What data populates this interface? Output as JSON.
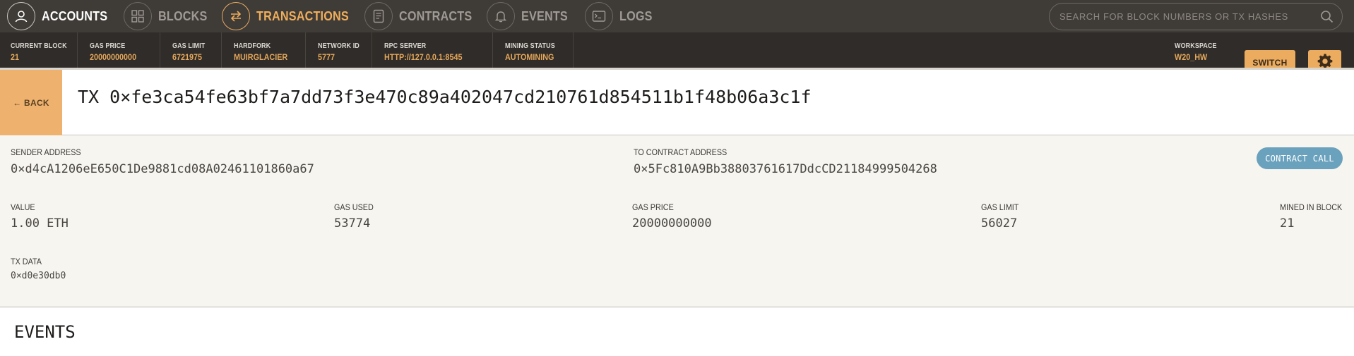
{
  "nav": {
    "items": [
      {
        "label": "ACCOUNTS",
        "icon": "account-icon",
        "state": "active"
      },
      {
        "label": "BLOCKS",
        "icon": "blocks-icon",
        "state": "inactive"
      },
      {
        "label": "TRANSACTIONS",
        "icon": "transactions-icon",
        "state": "selected"
      },
      {
        "label": "CONTRACTS",
        "icon": "contracts-icon",
        "state": "inactive"
      },
      {
        "label": "EVENTS",
        "icon": "bell-icon",
        "state": "inactive"
      },
      {
        "label": "LOGS",
        "icon": "logs-icon",
        "state": "inactive"
      }
    ],
    "search_placeholder": "SEARCH FOR BLOCK NUMBERS OR TX HASHES"
  },
  "status": {
    "current_block": {
      "label": "CURRENT BLOCK",
      "value": "21"
    },
    "gas_price": {
      "label": "GAS PRICE",
      "value": "20000000000"
    },
    "gas_limit": {
      "label": "GAS LIMIT",
      "value": "6721975"
    },
    "hardfork": {
      "label": "HARDFORK",
      "value": "MUIRGLACIER"
    },
    "network_id": {
      "label": "NETWORK ID",
      "value": "5777"
    },
    "rpc_server": {
      "label": "RPC SERVER",
      "value": "HTTP://127.0.0.1:8545"
    },
    "mining_status": {
      "label": "MINING STATUS",
      "value": "AUTOMINING"
    },
    "workspace": {
      "label": "WORKSPACE",
      "value": "W20_HW"
    },
    "switch_label": "SWITCH"
  },
  "tx": {
    "back_label": "← BACK",
    "title": "TX 0×fe3ca54fe63bf7a7dd73f3e470c89a402047cd210761d854511b1f48b06a3c1f",
    "sender": {
      "label": "SENDER ADDRESS",
      "value": "0×d4cA1206eE650C1De9881cd08A02461101860a67"
    },
    "to_contract": {
      "label": "TO CONTRACT ADDRESS",
      "value": "0×5Fc810A9Bb38803761617DdcCD21184999504268"
    },
    "badge": "CONTRACT CALL",
    "value": {
      "label": "VALUE",
      "value": "1.00 ETH"
    },
    "gas_used": {
      "label": "GAS USED",
      "value": "53774"
    },
    "gas_price": {
      "label": "GAS PRICE",
      "value": "20000000000"
    },
    "gas_limit": {
      "label": "GAS LIMIT",
      "value": "56027"
    },
    "mined_in_block": {
      "label": "MINED IN BLOCK",
      "value": "21"
    },
    "tx_data": {
      "label": "TX DATA",
      "value": "0×d0e30db0"
    }
  },
  "events": {
    "title": "EVENTS"
  },
  "colors": {
    "nav_bg": "#3f3b37",
    "status_bg": "#2f2c29",
    "accent": "#ecac5f",
    "badge": "#6aa1bd"
  }
}
